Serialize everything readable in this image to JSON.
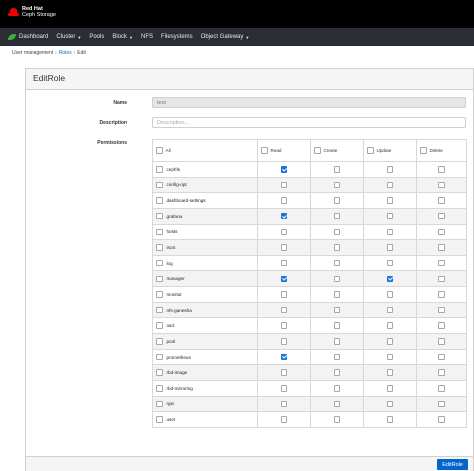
{
  "brand": {
    "line1": "Red Hat",
    "line2": "Ceph Storage"
  },
  "nav": {
    "items": [
      {
        "label": "Dashboard",
        "icon": "ceph-logo-icon",
        "dropdown": false
      },
      {
        "label": "Cluster",
        "dropdown": true
      },
      {
        "label": "Pools",
        "dropdown": false
      },
      {
        "label": "Block",
        "dropdown": true
      },
      {
        "label": "NFS",
        "dropdown": false
      },
      {
        "label": "Filesystems",
        "dropdown": false
      },
      {
        "label": "Object Gateway",
        "dropdown": true
      }
    ]
  },
  "breadcrumb": {
    "first": "User management",
    "second": "Roles",
    "third": "Edit",
    "sep": "›"
  },
  "form": {
    "title": "EditRole",
    "name_label": "Name",
    "name_value": "test",
    "description_label": "Description",
    "description_placeholder": "Description...",
    "permissions_label": "Permissions",
    "submit_label": "EditRole"
  },
  "permissions": {
    "headers": [
      "All",
      "Read",
      "Create",
      "Update",
      "Delete"
    ],
    "rows": [
      {
        "name": "cephfs",
        "read": true,
        "create": false,
        "update": false,
        "delete": false
      },
      {
        "name": "config-opt",
        "read": false,
        "create": false,
        "update": false,
        "delete": false
      },
      {
        "name": "dashboard-settings",
        "read": false,
        "create": false,
        "update": false,
        "delete": false
      },
      {
        "name": "grafana",
        "read": true,
        "create": false,
        "update": false,
        "delete": false
      },
      {
        "name": "hosts",
        "read": false,
        "create": false,
        "update": false,
        "delete": false
      },
      {
        "name": "iscsi",
        "read": false,
        "create": false,
        "update": false,
        "delete": false
      },
      {
        "name": "log",
        "read": false,
        "create": false,
        "update": false,
        "delete": false
      },
      {
        "name": "manager",
        "read": true,
        "create": false,
        "update": true,
        "delete": false
      },
      {
        "name": "monitor",
        "read": false,
        "create": false,
        "update": false,
        "delete": false
      },
      {
        "name": "nfs-ganesha",
        "read": false,
        "create": false,
        "update": false,
        "delete": false
      },
      {
        "name": "osd",
        "read": false,
        "create": false,
        "update": false,
        "delete": false
      },
      {
        "name": "pool",
        "read": false,
        "create": false,
        "update": false,
        "delete": false
      },
      {
        "name": "prometheus",
        "read": true,
        "create": false,
        "update": false,
        "delete": false
      },
      {
        "name": "rbd-image",
        "read": false,
        "create": false,
        "update": false,
        "delete": false
      },
      {
        "name": "rbd-mirroring",
        "read": false,
        "create": false,
        "update": false,
        "delete": false
      },
      {
        "name": "rgw",
        "read": false,
        "create": false,
        "update": false,
        "delete": false
      },
      {
        "name": "user",
        "read": false,
        "create": false,
        "update": false,
        "delete": false
      }
    ]
  },
  "colors": {
    "accent": "#0066cc",
    "checkbox_on": "#1a73d9",
    "brand_red": "#ee0000",
    "navbar": "#292e34"
  }
}
